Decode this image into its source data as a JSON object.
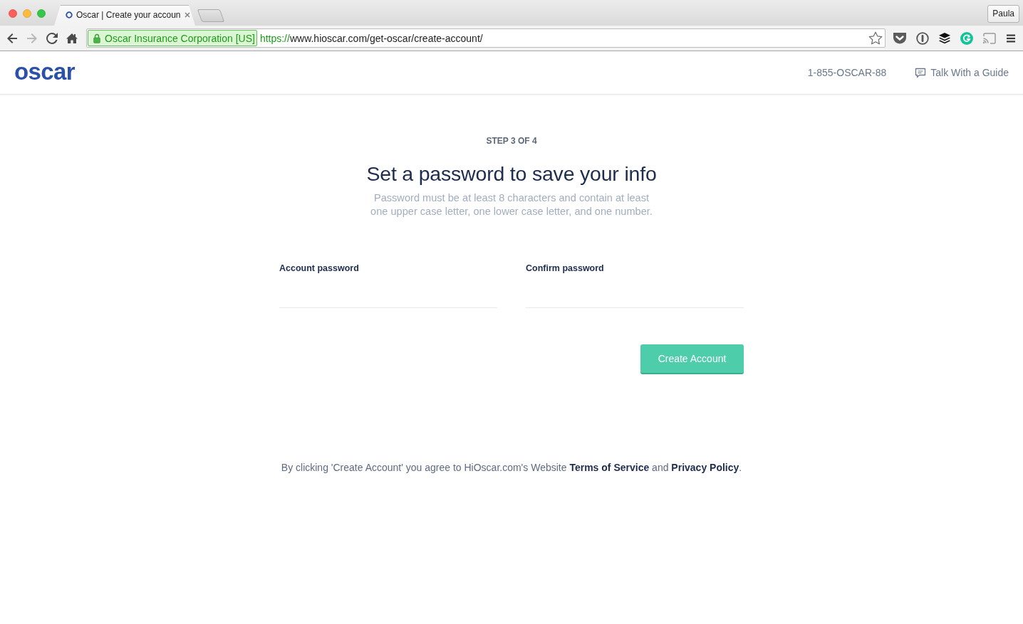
{
  "browser": {
    "tab": {
      "title": "Oscar | Create your accoun"
    },
    "profile": "Paula",
    "nav_buttons": [
      {
        "kind": "back",
        "disabled": false
      },
      {
        "kind": "forward",
        "disabled": true
      },
      {
        "kind": "reload",
        "disabled": false
      },
      {
        "kind": "home",
        "disabled": false
      }
    ],
    "address_bar": {
      "identity": "Oscar Insurance Corporation [US]",
      "scheme": "https://",
      "url": "www.hioscar.com/get-oscar/create-account/"
    }
  },
  "header": {
    "logo": "oscar",
    "phone": "1-855-OSCAR-88",
    "guide_link": "Talk With a Guide"
  },
  "form": {
    "step": "STEP 3 OF 4",
    "title": "Set a password to save your info",
    "hint": "Password must be at least 8 characters and contain at least one upper case letter, one lower case letter, and one number.",
    "fields": [
      {
        "label": "Account password"
      },
      {
        "label": "Confirm password"
      }
    ],
    "submit_button": "Create Account"
  },
  "agreement": [
    {
      "kind": "text",
      "text": "By clicking 'Create Account' you agree to HiOscar.com's Website "
    },
    {
      "kind": "link",
      "text": "Terms of Service"
    },
    {
      "kind": "text",
      "text": " and "
    },
    {
      "kind": "link",
      "text": "Privacy Policy"
    },
    {
      "kind": "text",
      "text": "."
    }
  ]
}
